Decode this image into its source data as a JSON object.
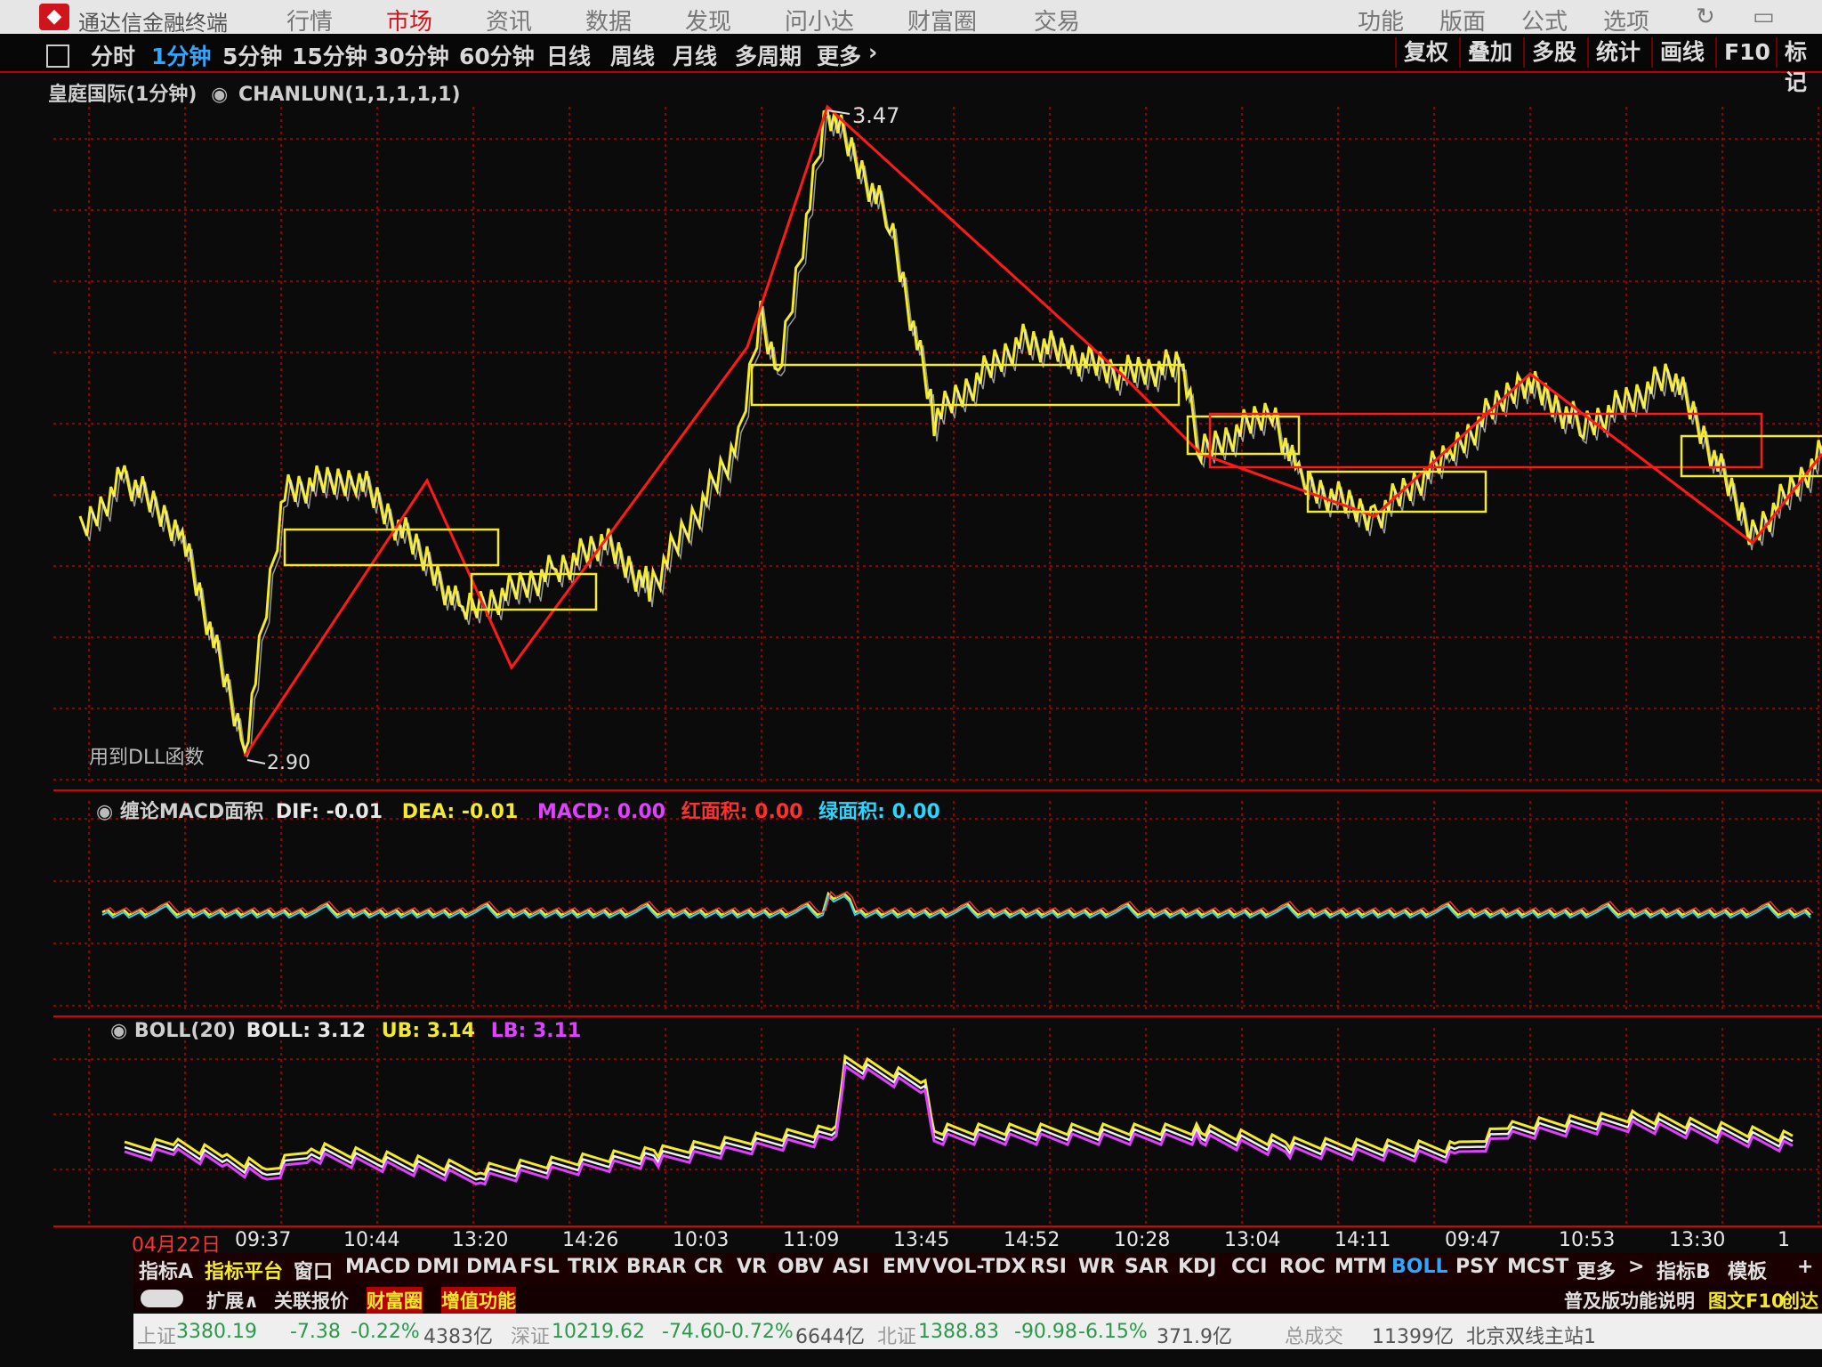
{
  "app": {
    "title": "通达信金融终端"
  },
  "menu": [
    "行情",
    "市场",
    "资讯",
    "数据",
    "发现",
    "问小达",
    "财富圈",
    "交易",
    "功能",
    "版面",
    "公式",
    "选项"
  ],
  "menu_active": "市场",
  "periods": [
    "分时",
    "1分钟",
    "5分钟",
    "15分钟",
    "30分钟",
    "60分钟",
    "日线",
    "周线",
    "月线",
    "多周期",
    "更多"
  ],
  "period_active": "1分钟",
  "tools": [
    "复权",
    "叠加",
    "多股",
    "统计",
    "画线",
    "F10",
    "标记"
  ],
  "main_panel": {
    "stock": "皇庭国际(1分钟)",
    "indicator": "CHANLUN(1,1,1,1,1)",
    "high_label": "3.47",
    "low_label": "2.90",
    "dll_note": "用到DLL函数"
  },
  "macd_panel": {
    "name": "缠论MACD面积",
    "dif": "DIF: -0.01",
    "dea": "DEA: -0.01",
    "macd": "MACD: 0.00",
    "red_area": "红面积: 0.00",
    "green_area": "绿面积: 0.00"
  },
  "boll_panel": {
    "name": "BOLL(20)",
    "boll": "BOLL: 3.12",
    "ub": "UB: 3.14",
    "lb": "LB: 3.11"
  },
  "time_axis": [
    "04月22日",
    "09:37",
    "10:44",
    "13:20",
    "14:26",
    "10:03",
    "11:09",
    "13:45",
    "14:52",
    "10:28",
    "13:04",
    "14:11",
    "09:47",
    "10:53",
    "13:30",
    "1"
  ],
  "indicator_tabs": [
    "指标A",
    "指标平台",
    "窗口",
    "MACD",
    "DMI",
    "DMA",
    "FSL",
    "TRIX",
    "BRAR",
    "CR",
    "VR",
    "OBV",
    "ASI",
    "EMV",
    "VOL-TDX",
    "RSI",
    "WR",
    "SAR",
    "KDJ",
    "CCI",
    "ROC",
    "MTM",
    "BOLL",
    "PSY",
    "MCST",
    "更多",
    ">",
    "指标B",
    "模板",
    "+"
  ],
  "indicator_active": "BOLL",
  "sub_tabs": [
    "扩展∧",
    "关联报价",
    "财富圈",
    "增值功能"
  ],
  "sub_right": [
    "普及版功能说明",
    "图文F10",
    "创达"
  ],
  "status": {
    "sh_name": "上证",
    "sh_val": "3380.19",
    "sh_chg": "-7.38",
    "sh_pct": "-0.22%",
    "sh_amt": "4383亿",
    "sz_name": "深证",
    "sz_val": "10219.62",
    "sz_chg": "-74.60",
    "sz_pct": "-0.72%",
    "sz_amt": "6644亿",
    "bz_name": "北证",
    "bz_val": "1388.83",
    "bz_chg": "-90.98",
    "bz_pct": "-6.15%",
    "bz_amt": "371.9亿",
    "total_label": "总成交",
    "total_val": "11399亿",
    "server": "北京双线主站1"
  }
}
